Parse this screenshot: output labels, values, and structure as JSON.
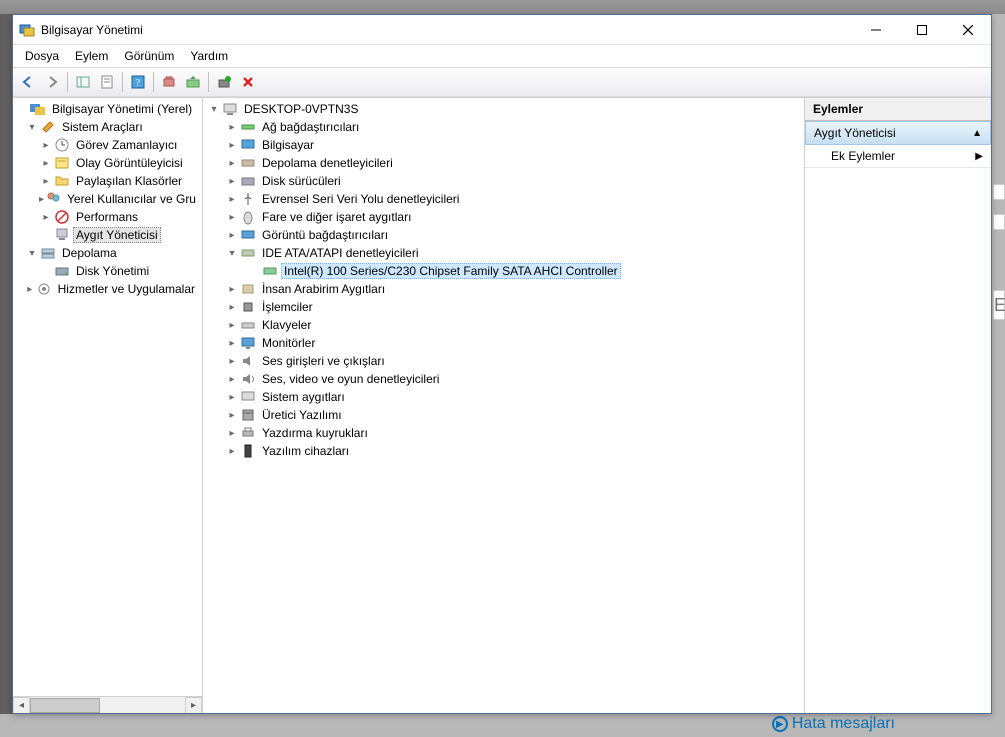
{
  "window": {
    "title": "Bilgisayar Yönetimi"
  },
  "menu": {
    "file": "Dosya",
    "action": "Eylem",
    "view": "Görünüm",
    "help": "Yardım"
  },
  "left_tree": {
    "root": "Bilgisayar Yönetimi (Yerel)",
    "sys": "Sistem Araçları",
    "task": "Görev Zamanlayıcı",
    "event": "Olay Görüntüleyicisi",
    "shared": "Paylaşılan Klasörler",
    "users": "Yerel Kullanıcılar ve Gru",
    "perf": "Performans",
    "devmgr": "Aygıt Yöneticisi",
    "storage": "Depolama",
    "disk": "Disk Yönetimi",
    "services": "Hizmetler ve Uygulamalar"
  },
  "center_tree": {
    "root": "DESKTOP-0VPTN3S",
    "net": "Ağ bağdaştırıcıları",
    "computer": "Bilgisayar",
    "storage_ctrl": "Depolama denetleyicileri",
    "disk_drives": "Disk sürücüleri",
    "usb": "Evrensel Seri Veri Yolu denetleyicileri",
    "mouse": "Fare ve diğer işaret aygıtları",
    "display": "Görüntü bağdaştırıcıları",
    "ide": "IDE ATA/ATAPI denetleyicileri",
    "ide_item": "Intel(R) 100 Series/C230 Chipset Family SATA AHCI Controller",
    "hid": "İnsan Arabirim Aygıtları",
    "cpu": "İşlemciler",
    "keyboard": "Klavyeler",
    "monitor": "Monitörler",
    "audio_io": "Ses girişleri ve çıkışları",
    "sound": "Ses, video ve oyun denetleyicileri",
    "sysdev": "Sistem aygıtları",
    "firmware": "Üretici Yazılımı",
    "print": "Yazdırma kuyrukları",
    "software": "Yazılım cihazları"
  },
  "actions": {
    "header": "Eylemler",
    "context": "Aygıt Yöneticisi",
    "more": "Ek Eylemler"
  },
  "background": {
    "hata": "Hata mesajları"
  }
}
